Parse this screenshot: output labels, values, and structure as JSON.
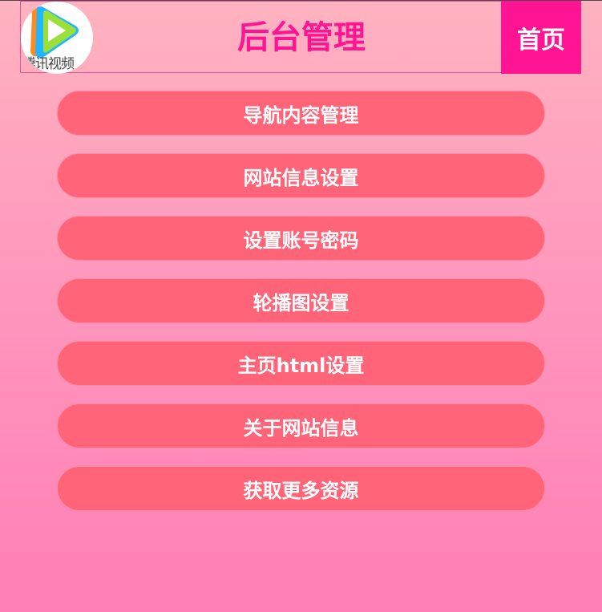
{
  "header": {
    "logo_text": "腾讯视频",
    "title": "后台管理",
    "home_label": "首页"
  },
  "menu": {
    "items": [
      {
        "label": "导航内容管理"
      },
      {
        "label": "网站信息设置"
      },
      {
        "label": "设置账号密码"
      },
      {
        "label": "轮播图设置"
      },
      {
        "label": "主页html设置"
      },
      {
        "label": "关于网站信息"
      },
      {
        "label": "获取更多资源"
      }
    ]
  },
  "colors": {
    "accent": "#ff1493",
    "menu_button": "#ff6478",
    "background_top": "#ffb3c0",
    "background_bottom": "#ff7fb6"
  },
  "icons": {
    "logo": "tencent-video-play-logo-icon"
  }
}
